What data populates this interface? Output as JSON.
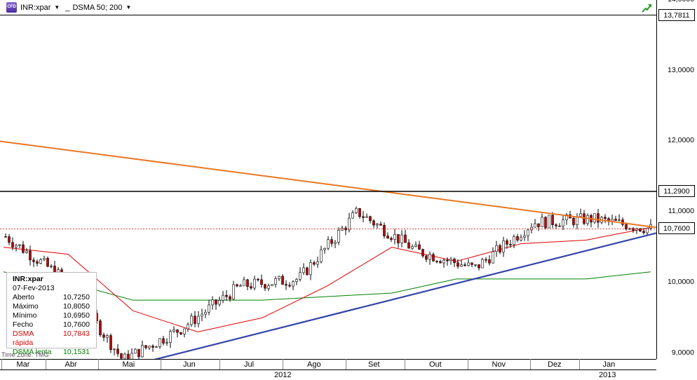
{
  "header": {
    "symbol_icon": "CFD",
    "symbol": "INR:xpar",
    "separator": "_",
    "study": "DSMA 50; 200",
    "autoscale_icon": "trend-arrow-icon"
  },
  "infobox": {
    "symbol": "INR:xpar",
    "date": "07-Fev-2013",
    "rows": [
      {
        "label": "Aberto",
        "value": "10,7250",
        "color": "#000000"
      },
      {
        "label": "Máximo",
        "value": "10,8050",
        "color": "#000000"
      },
      {
        "label": "Mínimo",
        "value": "10,6950",
        "color": "#000000"
      },
      {
        "label": "Fecho",
        "value": "10,7600",
        "color": "#000000"
      },
      {
        "label": "DSMA rápida",
        "value": "10,7843",
        "color": "#e00000"
      },
      {
        "label": "DSMA lenta",
        "value": "10,1531",
        "color": "#008000"
      }
    ]
  },
  "timezone": "Time Zone: TMG",
  "chart_data": {
    "type": "candlestick",
    "symbol": "INR:xpar",
    "ylim": [
      8.5,
      14.0
    ],
    "y_ticks": [
      "14,0000",
      "13,0000",
      "12,0000",
      "11,0000",
      "10,0000",
      "9,0000"
    ],
    "y_tick_values": [
      14.0,
      13.0,
      12.0,
      11.0,
      10.0,
      9.0
    ],
    "price_tags": [
      {
        "label": "13,7811",
        "value": 13.7811
      },
      {
        "label": "11,2900",
        "value": 11.29
      },
      {
        "label": "10,7600",
        "value": 10.76
      }
    ],
    "x_months": [
      "Mar",
      "Abr",
      "Mai",
      "Jun",
      "Jul",
      "Ago",
      "Set",
      "Out",
      "Nov",
      "Dez",
      "Jan"
    ],
    "x_years": [
      "2012",
      "2013"
    ],
    "colors": {
      "candle_up": "#ffffff",
      "candle_down": "#c00000",
      "fast_ma": "#e00000",
      "slow_ma": "#008000",
      "resistance": "#e87722",
      "support": "#3344aa",
      "horizontal": "#000000"
    },
    "close_sample": [
      {
        "month": "Mar",
        "close": 10.65
      },
      {
        "month": "Abr",
        "close": 10.05
      },
      {
        "month": "Mai",
        "close": 8.9
      },
      {
        "month": "Jun",
        "close": 9.35
      },
      {
        "month": "Jul",
        "close": 9.95
      },
      {
        "month": "Ago",
        "close": 10.05
      },
      {
        "month": "Set",
        "close": 11.0
      },
      {
        "month": "Out",
        "close": 10.45
      },
      {
        "month": "Nov",
        "close": 10.2
      },
      {
        "month": "Dez",
        "close": 10.85
      },
      {
        "month": "Jan",
        "close": 10.9
      },
      {
        "month": "Fev",
        "close": 10.76
      }
    ],
    "fast_ma_sample": [
      10.5,
      10.4,
      9.6,
      9.3,
      9.5,
      9.95,
      10.5,
      10.3,
      10.55,
      10.6,
      10.78
    ],
    "slow_ma_sample": [
      10.15,
      10.0,
      9.75,
      9.75,
      9.75,
      9.8,
      9.85,
      10.05,
      10.05,
      10.05,
      10.15
    ],
    "lines": [
      {
        "name": "resistance",
        "from": [
          0,
          12.0
        ],
        "to": [
          1,
          10.78
        ]
      },
      {
        "name": "support",
        "from": [
          0,
          8.85
        ],
        "to": [
          1,
          10.7
        ]
      },
      {
        "name": "horizontal",
        "value": 11.29
      }
    ]
  }
}
